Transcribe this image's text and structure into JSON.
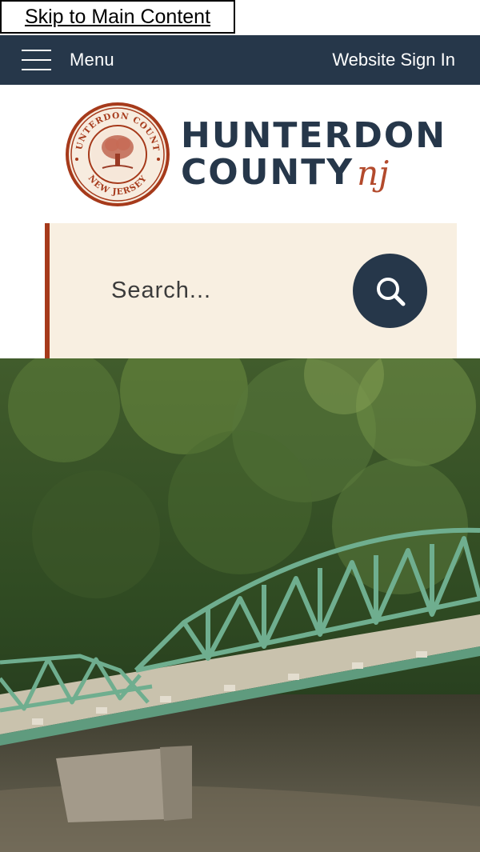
{
  "skip_link": {
    "label": "Skip to Main Content"
  },
  "header": {
    "menu_label": "Menu",
    "signin_label": "Website Sign In"
  },
  "logo": {
    "line1": "HUNTERDON",
    "line2": "COUNTY",
    "suffix": "nj",
    "seal_top_text": "HUNTERDON COUNTY",
    "seal_bottom_text": "NEW JERSEY"
  },
  "search": {
    "placeholder": "Search..."
  },
  "colors": {
    "navy": "#26374a",
    "rust": "#a63a1b",
    "cream": "#f8efe1",
    "bridge_green": "#6fae8f"
  },
  "icons": [
    "hamburger-icon",
    "search-icon",
    "seal-logo"
  ]
}
